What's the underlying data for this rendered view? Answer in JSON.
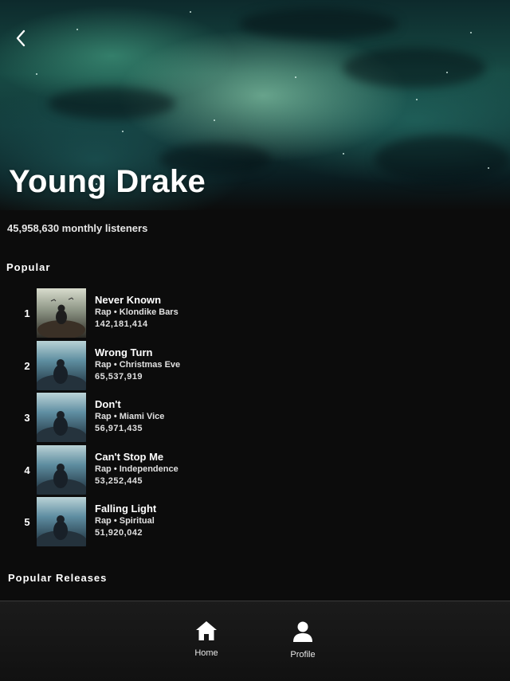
{
  "artist": {
    "name": "Young Drake",
    "monthly_listeners": "45,958,630 monthly listeners"
  },
  "nav": {
    "back_icon": "chevron-left-icon"
  },
  "sections": {
    "popular": "Popular",
    "popular_releases": "Popular Releases"
  },
  "tracks": [
    {
      "rank": "1",
      "title": "Never Known",
      "subtitle": "Rap • Klondike Bars",
      "plays": "142,181,414"
    },
    {
      "rank": "2",
      "title": "Wrong Turn",
      "subtitle": "Rap • Christmas Eve",
      "plays": "65,537,919"
    },
    {
      "rank": "3",
      "title": "Don't",
      "subtitle": "Rap • Miami Vice",
      "plays": "56,971,435"
    },
    {
      "rank": "4",
      "title": "Can't Stop Me",
      "subtitle": "Rap • Independence",
      "plays": "53,252,445"
    },
    {
      "rank": "5",
      "title": "Falling Light",
      "subtitle": "Rap • Spiritual",
      "plays": "51,920,042"
    }
  ],
  "tabbar": {
    "home_label": "Home",
    "home_icon": "home-icon",
    "profile_label": "Profile",
    "profile_icon": "user-icon"
  },
  "colors": {
    "background": "#0c0c0c",
    "hero_accent": "#2fa87a",
    "text": "#ffffff"
  }
}
